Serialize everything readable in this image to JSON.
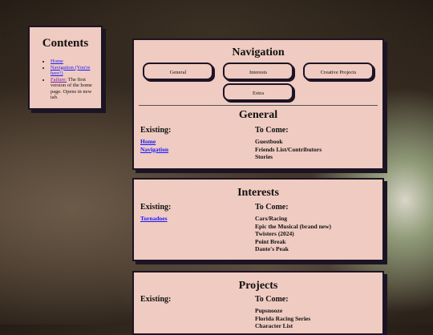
{
  "contents": {
    "title": "Contents",
    "items": [
      {
        "link": "Home",
        "text": ""
      },
      {
        "link": "Navigation (You're here!)",
        "text": ""
      },
      {
        "link": "Failure:",
        "text": " The first version of the home page. Opens in new tab."
      }
    ]
  },
  "navigation": {
    "title": "Navigation",
    "buttons": [
      "General",
      "Interests",
      "Creative Projects",
      "Extra"
    ],
    "general": {
      "title": "General",
      "existing_label": "Existing:",
      "to_come_label": "To Come:",
      "existing": [
        "Home",
        "Navigation"
      ],
      "to_come": [
        "Guestbook",
        "Friends List/Contributors",
        "Stories"
      ]
    }
  },
  "interests": {
    "title": "Interests",
    "existing_label": "Existing:",
    "to_come_label": "To Come:",
    "existing": [
      "Tornadoes"
    ],
    "to_come": [
      "Cars/Racing",
      "Epic the Musical (brand new)",
      "Twisters (2024)",
      "Point Break",
      "Dante's Peak"
    ]
  },
  "projects": {
    "title": "Projects",
    "existing_label": "Existing:",
    "to_come_label": "To Come:",
    "existing": [],
    "to_come": [
      "Pupsnooze",
      "Florida Racing Series",
      "Character List"
    ]
  }
}
